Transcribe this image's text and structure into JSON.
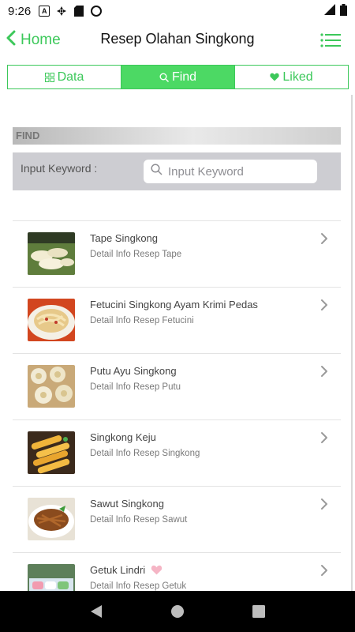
{
  "status_bar": {
    "time": "9:26",
    "icons": [
      "a-notification-icon",
      "fan-icon",
      "sd-card-icon",
      "sync-icon",
      "signal-icon",
      "battery-icon"
    ]
  },
  "app_bar": {
    "back_label": "Home",
    "title": "Resep Olahan Singkong",
    "accent": "#3cc85a"
  },
  "tabs": [
    {
      "label": "Data",
      "icon": "grid-icon",
      "active": false
    },
    {
      "label": "Find",
      "icon": "search-icon",
      "active": true
    },
    {
      "label": "Liked",
      "icon": "heart-icon",
      "active": false
    }
  ],
  "find": {
    "header": "FIND",
    "keyword_label": "Input Keyword :",
    "placeholder": "Input Keyword",
    "value": ""
  },
  "recipes": [
    {
      "title": "Tape Singkong",
      "subtitle": "Detail Info Resep Tape",
      "liked": false
    },
    {
      "title": "Fetucini Singkong Ayam Krimi Pedas",
      "subtitle": "Detail Info Resep Fetucini",
      "liked": false
    },
    {
      "title": "Putu Ayu Singkong",
      "subtitle": "Detail Info Resep Putu",
      "liked": false
    },
    {
      "title": "Singkong Keju",
      "subtitle": "Detail Info Resep Singkong",
      "liked": false
    },
    {
      "title": "Sawut Singkong",
      "subtitle": "Detail Info Resep Sawut",
      "liked": false
    },
    {
      "title": "Getuk Lindri",
      "subtitle": "Detail Info Resep Getuk",
      "liked": true
    }
  ],
  "nav": [
    "back-triangle-icon",
    "home-circle-icon",
    "recents-square-icon"
  ]
}
